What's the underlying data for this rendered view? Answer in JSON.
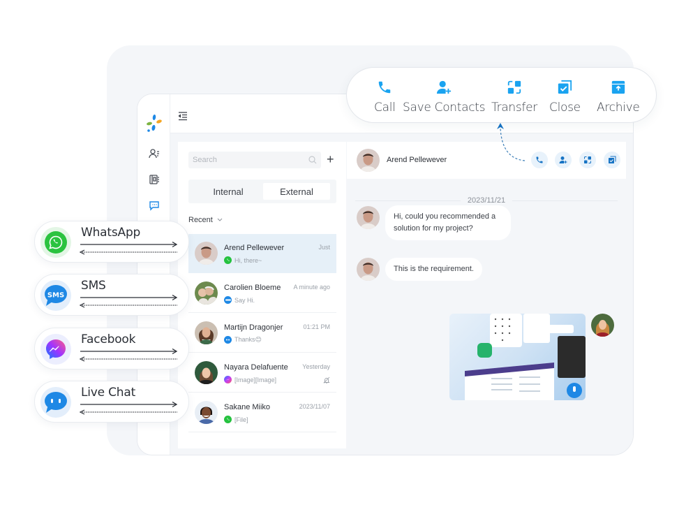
{
  "actions": [
    {
      "label": "Call",
      "icon": "phone-icon"
    },
    {
      "label": "Save Contacts",
      "icon": "add-contact-icon"
    },
    {
      "label": "Transfer",
      "icon": "transfer-icon"
    },
    {
      "label": "Close",
      "icon": "close-session-icon"
    },
    {
      "label": "Archive",
      "icon": "archive-icon"
    }
  ],
  "channels": [
    {
      "label": "WhatsApp",
      "icon": "whatsapp-icon",
      "color": "#25c23f"
    },
    {
      "label": "SMS",
      "icon": "sms-icon",
      "color": "#1e88e5"
    },
    {
      "label": "Facebook",
      "icon": "messenger-icon",
      "color": "#a033ff"
    },
    {
      "label": "Live Chat",
      "icon": "live-chat-icon",
      "color": "#1e88e5"
    }
  ],
  "rail": {
    "items": [
      {
        "name": "contacts",
        "icon": "contacts-icon"
      },
      {
        "name": "phonebook",
        "icon": "phonebook-icon"
      },
      {
        "name": "messages",
        "icon": "message-icon",
        "active": true
      }
    ]
  },
  "list": {
    "search_placeholder": "Search",
    "add_label": "+",
    "tabs": [
      "Internal",
      "External"
    ],
    "active_tab": "External",
    "filter_label": "Recent",
    "conversations": [
      {
        "name": "Arend Pellewever",
        "time": "Just",
        "channel": "whatsapp",
        "preview": "Hi,  there~",
        "active": true
      },
      {
        "name": "Carolien Bloeme",
        "time": "A minute ago",
        "channel": "sms",
        "preview": "Say Hi."
      },
      {
        "name": "Martijn Dragonjer",
        "time": "01:21 PM",
        "channel": "livechat",
        "preview": "Thanks😊"
      },
      {
        "name": "Nayara Delafuente",
        "time": "Yesterday",
        "channel": "messenger",
        "preview": "[Image][Image]",
        "muted": true
      },
      {
        "name": "Sakane Miiko",
        "time": "2023/11/07",
        "channel": "whatsapp",
        "preview": "[File]"
      }
    ]
  },
  "chat": {
    "contact_name": "Arend Pellewever",
    "date": "2023/11/21",
    "messages": [
      {
        "from": "contact",
        "text": "Hi, could you recommended a solution for my project?"
      },
      {
        "from": "contact",
        "text": "This is the requirement."
      },
      {
        "from": "agent",
        "type": "image"
      }
    ]
  },
  "colors": {
    "accent": "#1aa3f0",
    "active_row": "#e6f0f8",
    "backdrop": "#f4f6f9"
  }
}
